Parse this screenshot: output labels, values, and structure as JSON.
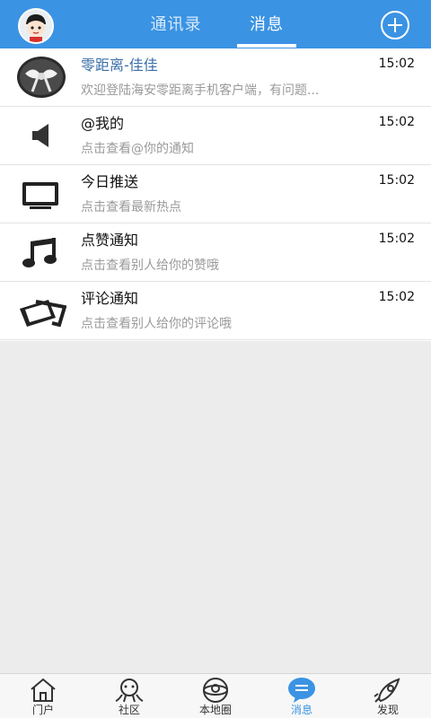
{
  "header": {
    "tabs": [
      {
        "label": "通讯录",
        "active": false
      },
      {
        "label": "消息",
        "active": true
      }
    ],
    "accent_color": "#3b93e3"
  },
  "messages": [
    {
      "icon": "user-photo-avatar",
      "title": "零距离-佳佳",
      "time": "15:02",
      "preview": "欢迎登陆海安零距离手机客户端，有问题..."
    },
    {
      "icon": "speaker-icon",
      "title": "@我的",
      "time": "15:02",
      "preview": "点击查看@你的通知"
    },
    {
      "icon": "monitor-icon",
      "title": "今日推送",
      "time": "15:02",
      "preview": "点击查看最新热点"
    },
    {
      "icon": "music-note-icon",
      "title": "点赞通知",
      "time": "15:02",
      "preview": "点击查看别人给你的赞哦"
    },
    {
      "icon": "comment-card-icon",
      "title": "评论通知",
      "time": "15:02",
      "preview": "点击查看别人给你的评论哦"
    }
  ],
  "bottom_nav": [
    {
      "icon": "home-icon",
      "label": "门户"
    },
    {
      "icon": "community-icon",
      "label": "社区"
    },
    {
      "icon": "local-circle-icon",
      "label": "本地圈"
    },
    {
      "icon": "message-bubble-icon",
      "label": "消息",
      "active": true
    },
    {
      "icon": "rocket-icon",
      "label": "发现"
    }
  ]
}
